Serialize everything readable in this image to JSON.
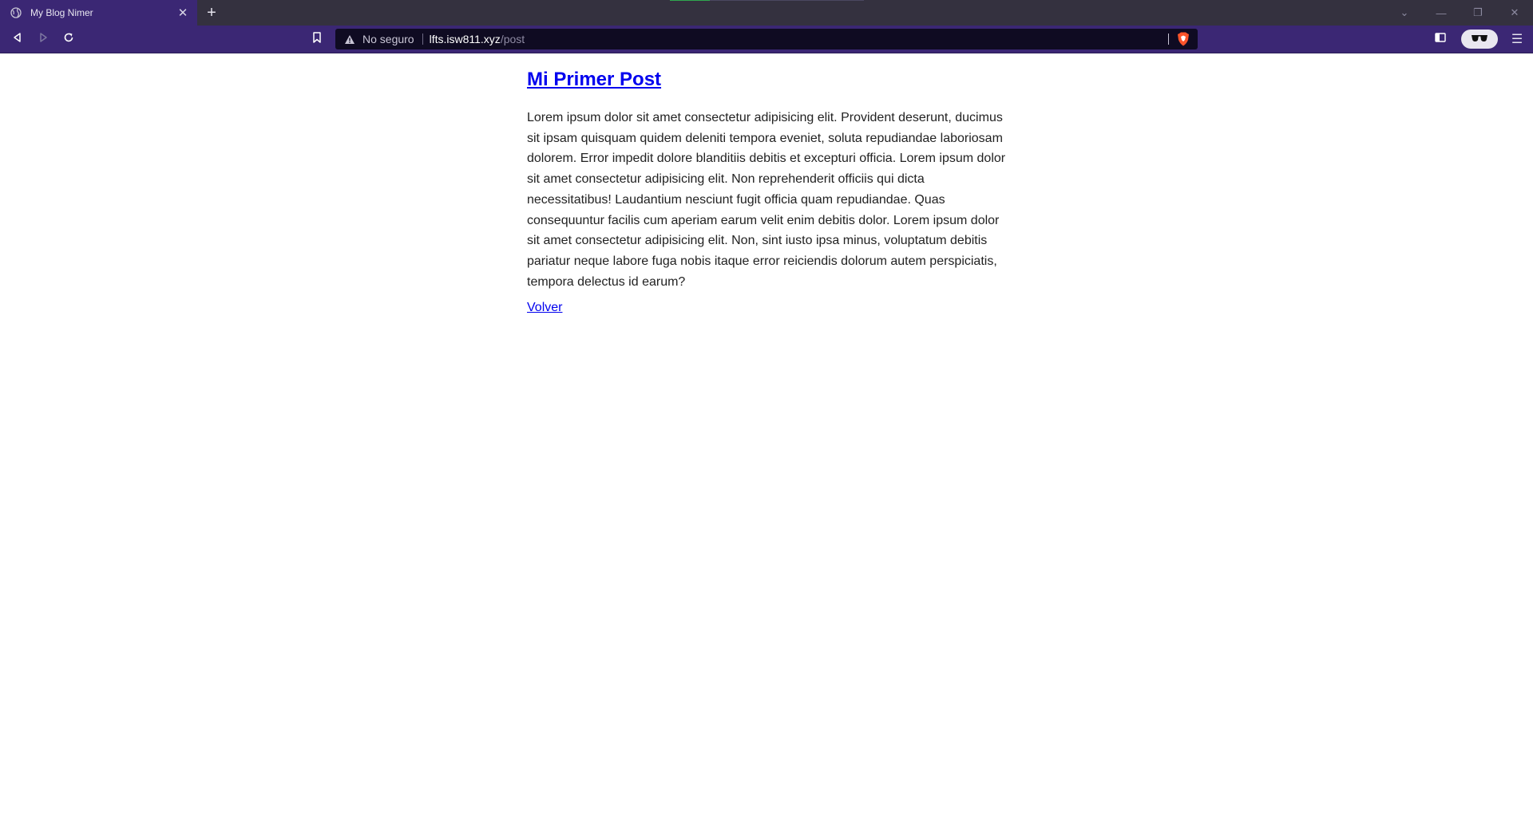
{
  "browser": {
    "tab": {
      "title": "My Blog Nimer",
      "favicon": "globe-icon",
      "close_glyph": "✕"
    },
    "new_tab_glyph": "+",
    "window_controls": {
      "tabs_dropdown": "⌄",
      "minimize": "—",
      "restore": "❐",
      "close": "✕"
    },
    "address_bar": {
      "security_label": "No seguro",
      "host": "lfts.isw811.xyz",
      "path": "/post"
    },
    "menu_glyph": "☰",
    "colors": {
      "tab_strip": "#34313f",
      "toolbar": "#3b2774",
      "omnibox": "#0f0b22",
      "shields": "#fb542b"
    }
  },
  "post": {
    "title": "Mi Primer Post",
    "body": "Lorem ipsum dolor sit amet consectetur adipisicing elit. Provident deserunt, ducimus sit ipsam quisquam quidem deleniti tempora eveniet, soluta repudiandae laboriosam dolorem. Error impedit dolore blanditiis debitis et excepturi officia. Lorem ipsum dolor sit amet consectetur adipisicing elit. Non reprehenderit officiis qui dicta necessitatibus! Laudantium nesciunt fugit officia quam repudiandae. Quas consequuntur facilis cum aperiam earum velit enim debitis dolor. Lorem ipsum dolor sit amet consectetur adipisicing elit. Non, sint iusto ipsa minus, voluptatum debitis pariatur neque labore fuga nobis itaque error reiciendis dolorum autem perspiciatis, tempora delectus id earum?",
    "back_link": "Volver",
    "link_color": "#0000ee"
  }
}
